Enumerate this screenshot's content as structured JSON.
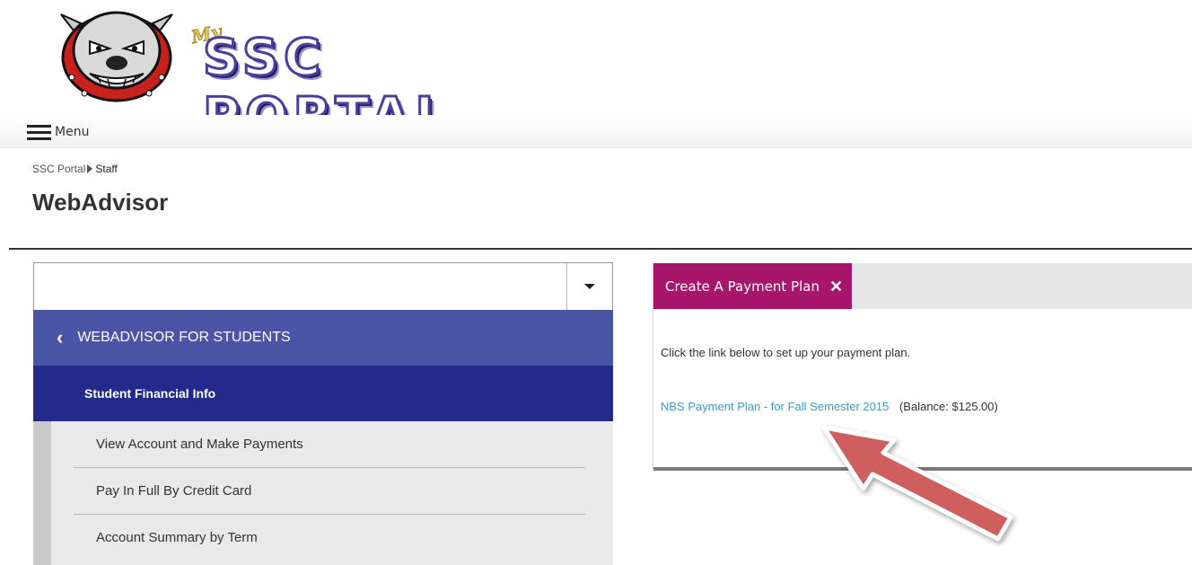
{
  "header": {
    "logo_my": "My",
    "logo_text": "SSC PORTAL"
  },
  "menu_bar": {
    "menu_label": "Menu"
  },
  "breadcrumb": {
    "root": "SSC Portal",
    "current": "Staff"
  },
  "page": {
    "title": "WebAdvisor"
  },
  "left_panel": {
    "select_value": "",
    "nav_header": "WEBADVISOR FOR STUDENTS",
    "section": "Student Financial Info",
    "items": [
      {
        "label": "View Account and Make Payments"
      },
      {
        "label": "Pay In Full By Credit Card"
      },
      {
        "label": "Account Summary by Term"
      }
    ]
  },
  "right_panel": {
    "tab_label": "Create A Payment Plan",
    "tab_close": "✕",
    "instruction": "Click the link below to set up your payment plan.",
    "plan_link": "NBS Payment Plan - for Fall Semester 2015",
    "plan_balance": "(Balance: $125.00)"
  },
  "colors": {
    "nav_header_bg": "#4a55a6",
    "nav_section_bg": "#232a8c",
    "tab_bg": "#a8166b",
    "link": "#3b9bd4",
    "arrow": "#cf5f5f"
  },
  "icons": {
    "logo": "bulldog-mascot-icon",
    "menu": "hamburger-icon",
    "breadcrumb_sep": "triangle-right-icon",
    "select": "caret-down-icon",
    "back": "chevron-left-icon",
    "close": "close-icon",
    "annotation": "arrow-annotation-icon"
  }
}
